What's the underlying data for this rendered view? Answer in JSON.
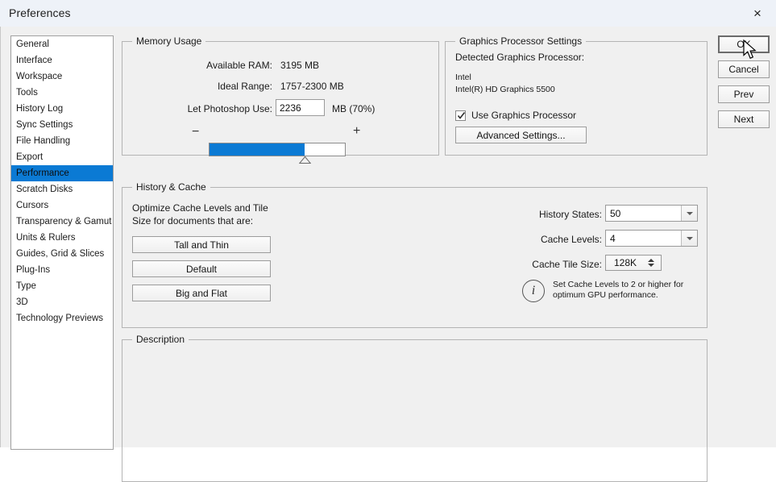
{
  "window": {
    "title": "Preferences",
    "close_label": "×"
  },
  "sidebar": {
    "items": [
      {
        "label": "General",
        "selected": false
      },
      {
        "label": "Interface",
        "selected": false
      },
      {
        "label": "Workspace",
        "selected": false
      },
      {
        "label": "Tools",
        "selected": false
      },
      {
        "label": "History Log",
        "selected": false
      },
      {
        "label": "Sync Settings",
        "selected": false
      },
      {
        "label": "File Handling",
        "selected": false
      },
      {
        "label": "Export",
        "selected": false
      },
      {
        "label": "Performance",
        "selected": true
      },
      {
        "label": "Scratch Disks",
        "selected": false
      },
      {
        "label": "Cursors",
        "selected": false
      },
      {
        "label": "Transparency & Gamut",
        "selected": false
      },
      {
        "label": "Units & Rulers",
        "selected": false
      },
      {
        "label": "Guides, Grid & Slices",
        "selected": false
      },
      {
        "label": "Plug-Ins",
        "selected": false
      },
      {
        "label": "Type",
        "selected": false
      },
      {
        "label": "3D",
        "selected": false
      },
      {
        "label": "Technology Previews",
        "selected": false
      }
    ]
  },
  "memory": {
    "group_label": "Memory Usage",
    "available_ram_label": "Available RAM:",
    "available_ram_value": "3195 MB",
    "ideal_range_label": "Ideal Range:",
    "ideal_range_value": "1757-2300 MB",
    "let_use_label": "Let Photoshop Use:",
    "let_use_value": "2236",
    "unit_suffix": "MB (70%)",
    "minus_label": "−",
    "plus_label": "+",
    "slider_percent": 70
  },
  "gpu": {
    "group_label": "Graphics Processor Settings",
    "detected_label": "Detected Graphics Processor:",
    "vendor": "Intel",
    "model": "Intel(R) HD Graphics 5500",
    "use_gpu_label": "Use Graphics Processor",
    "use_gpu_checked": true,
    "advanced_button": "Advanced Settings..."
  },
  "history_cache": {
    "group_label": "History & Cache",
    "optimize_text": "Optimize Cache Levels and Tile Size for documents that are:",
    "preset_tall": "Tall and Thin",
    "preset_default": "Default",
    "preset_big": "Big and Flat",
    "history_states_label": "History States:",
    "history_states_value": "50",
    "cache_levels_label": "Cache Levels:",
    "cache_levels_value": "4",
    "cache_tile_label": "Cache Tile Size:",
    "cache_tile_value": "128K",
    "hint_text": "Set Cache Levels to 2 or higher for optimum GPU performance."
  },
  "description": {
    "group_label": "Description",
    "body_text": ""
  },
  "actions": {
    "ok": "OK",
    "cancel": "Cancel",
    "prev": "Prev",
    "next": "Next"
  },
  "colors": {
    "accent": "#0b7ad4",
    "dialog_bg": "#f0f0f0",
    "titlebar_bg": "#eef2f8"
  }
}
